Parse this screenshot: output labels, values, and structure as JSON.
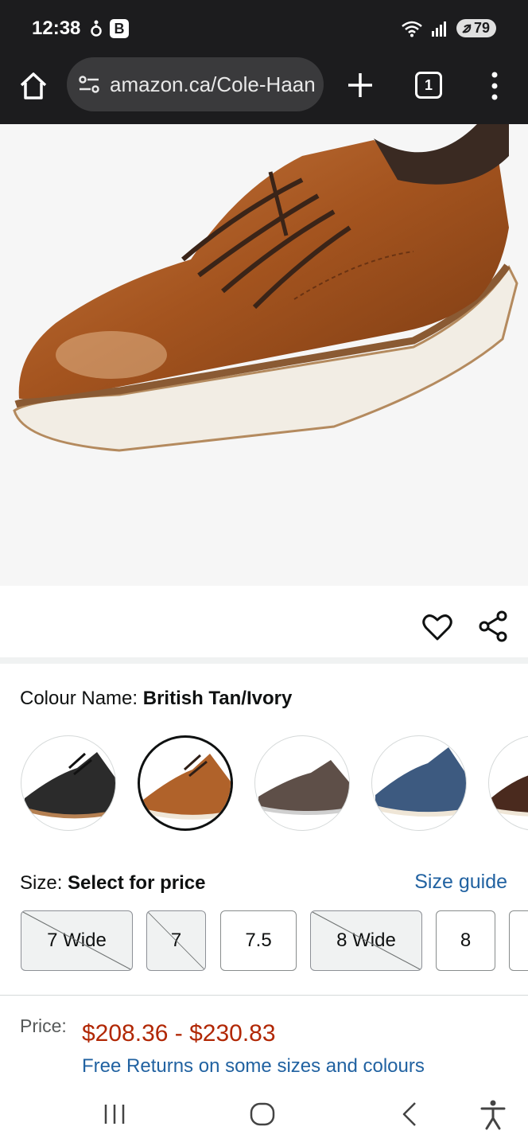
{
  "status_bar": {
    "time": "12:38",
    "left_icons": [
      "accessibility-status-icon",
      "b-app-icon"
    ],
    "b_badge": "B",
    "right_icons": [
      "wifi-icon",
      "signal-icon"
    ],
    "battery": "79"
  },
  "browser": {
    "url": "amazon.ca/Cole-Haan",
    "tab_count": "1"
  },
  "product": {
    "colour_label": "Colour Name:",
    "colour_value": "British Tan/Ivory",
    "swatches": [
      {
        "name": "Black",
        "selected": false
      },
      {
        "name": "British Tan/Ivory",
        "selected": true
      },
      {
        "name": "Grey",
        "selected": false
      },
      {
        "name": "Navy",
        "selected": false
      },
      {
        "name": "Brown",
        "selected": false
      }
    ],
    "size_label": "Size:",
    "size_value": "Select for price",
    "size_guide": "Size guide",
    "sizes": [
      {
        "label": "7 Wide",
        "available": false
      },
      {
        "label": "7",
        "available": false
      },
      {
        "label": "7.5",
        "available": true
      },
      {
        "label": "8 Wide",
        "available": false
      },
      {
        "label": "8",
        "available": true
      }
    ],
    "price_label": "Price:",
    "price_range": "$208.36 - $230.83",
    "free_returns": "Free Returns on some sizes and colours"
  },
  "colors": {
    "price": "#b12704",
    "link": "#2162a1",
    "browser_chrome": "#1c1c1e"
  }
}
